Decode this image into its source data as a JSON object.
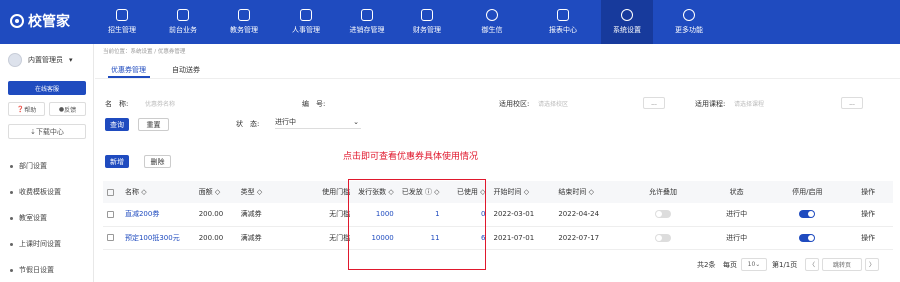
{
  "logo": "校管家",
  "nav": [
    {
      "label": "招生管理"
    },
    {
      "label": "前台业务"
    },
    {
      "label": "教务管理"
    },
    {
      "label": "人事管理"
    },
    {
      "label": "进销存管理"
    },
    {
      "label": "财务管理"
    },
    {
      "label": "御生信"
    },
    {
      "label": "报表中心"
    },
    {
      "label": "系统设置"
    },
    {
      "label": "更多功能"
    }
  ],
  "sidebar": {
    "user": "内置管理员",
    "online": "在线客服",
    "help": "帮助",
    "feedback": "反馈",
    "download": "下载中心",
    "items": [
      {
        "label": "部门设置"
      },
      {
        "label": "收费模板设置"
      },
      {
        "label": "教室设置"
      },
      {
        "label": "上课时间设置"
      },
      {
        "label": "节假日设置"
      }
    ]
  },
  "breadcrumb": "当前位置：系统设置 / 优惠券管理",
  "tabs": [
    {
      "label": "优惠券管理"
    },
    {
      "label": "自动送券"
    }
  ],
  "filters": {
    "name_label": "名　称:",
    "name_placeholder": "优惠券名称",
    "code_label": "编　号:",
    "campus_label": "适用校区:",
    "campus_placeholder": "请选择校区",
    "course_label": "适用课程:",
    "course_placeholder": "请选择课程",
    "dots": "...",
    "status_label": "状　态:",
    "status_value": "进行中",
    "query": "查询",
    "reset": "重置"
  },
  "actions": {
    "add": "新增",
    "delete": "删除"
  },
  "hint": "点击即可查看优惠券具体使用情况",
  "table": {
    "headers": [
      "名称 ◇",
      "面额 ◇",
      "类型 ◇",
      "使用门槛",
      "发行张数 ◇",
      "已发放 ⓘ ◇",
      "已使用 ◇",
      "开始时间 ◇",
      "结束时间 ◇",
      "允许叠加",
      "状态",
      "停用/启用",
      "操作"
    ],
    "rows": [
      {
        "name": "直减200券",
        "amount": "200.00",
        "type": "满减券",
        "threshold": "无门槛",
        "issued": "1000",
        "distributed": "1",
        "used": "0",
        "start": "2022-03-01",
        "end": "2022-04-24",
        "stack": false,
        "status": "进行中",
        "enabled": true,
        "op": "操作"
      },
      {
        "name": "预定100抵300元",
        "amount": "200.00",
        "type": "满减券",
        "threshold": "无门槛",
        "issued": "10000",
        "distributed": "11",
        "used": "6",
        "start": "2021-07-01",
        "end": "2022-07-17",
        "stack": false,
        "status": "进行中",
        "enabled": true,
        "op": "操作"
      }
    ]
  },
  "pager": {
    "total": "共2条",
    "per_page": "每页",
    "size": "10",
    "page": "第1/1页",
    "prev": "〈",
    "first": "跳转页",
    "next": "〉"
  }
}
